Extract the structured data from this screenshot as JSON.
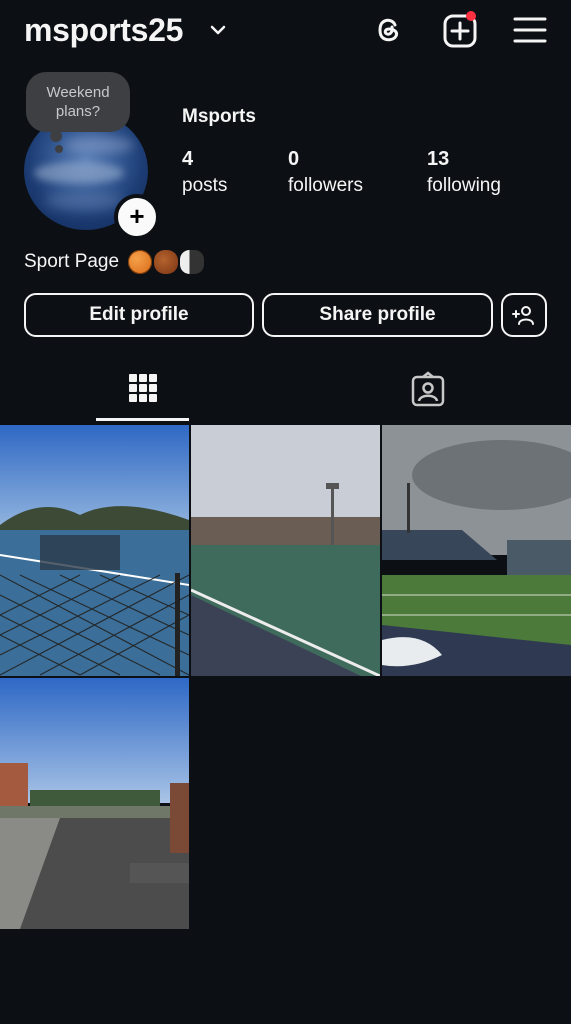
{
  "header": {
    "username": "msports25",
    "icons": [
      "threads-icon",
      "create-post-icon",
      "menu-icon"
    ],
    "notification_color": "#ff3040"
  },
  "profile": {
    "note": [
      "Weekend",
      "plans?"
    ],
    "display_name": "Msports",
    "stats": [
      {
        "value": "4",
        "label": "posts"
      },
      {
        "value": "0",
        "label": "followers"
      },
      {
        "value": "13",
        "label": "following"
      }
    ],
    "bio": "Sport Page",
    "bio_emojis": [
      "basketball",
      "american-football",
      "bowling"
    ]
  },
  "buttons": {
    "edit": "Edit profile",
    "share": "Share profile",
    "add_person_icon": "add-person-icon"
  },
  "tabs": [
    {
      "icon": "grid-icon",
      "active": true
    },
    {
      "icon": "tagged-icon",
      "active": false
    }
  ],
  "posts": [
    {
      "subject": "tennis courts"
    },
    {
      "subject": "turf field"
    },
    {
      "subject": "stadium field"
    },
    {
      "subject": "campus lot"
    }
  ],
  "colors": {
    "background": "#0c1014",
    "text": "#f5f5f5"
  }
}
